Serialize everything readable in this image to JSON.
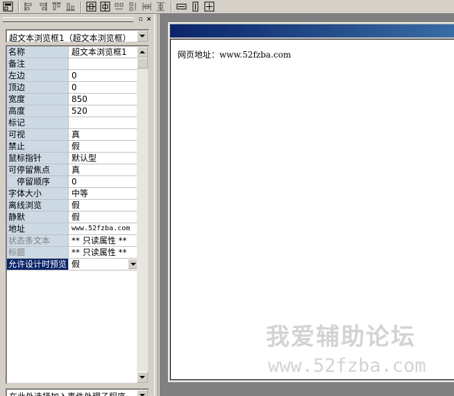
{
  "toolbar": {
    "buttons": [
      "form-icon",
      "align-left-icon",
      "align-right-icon",
      "align-top-icon",
      "align-bottom-icon",
      "center-horizontal-icon",
      "center-vertical-icon",
      "space-horizontal-icon",
      "space-vertical-icon",
      "distribute-horizontal-icon",
      "distribute-vertical-icon",
      "same-width-icon",
      "same-height-icon",
      "same-size-icon"
    ]
  },
  "panel": {
    "restore_glyph": "▫",
    "close_glyph": "×",
    "object_selector": "超文本浏览框1（超文本浏览框）",
    "event_selector": "在此处选择加入事件处理子程序"
  },
  "properties": [
    {
      "name": "名称",
      "value": "超文本浏览框1"
    },
    {
      "name": "备注",
      "value": ""
    },
    {
      "name": "左边",
      "value": "0"
    },
    {
      "name": "顶边",
      "value": "0"
    },
    {
      "name": "宽度",
      "value": "850"
    },
    {
      "name": "高度",
      "value": "520"
    },
    {
      "name": "标记",
      "value": ""
    },
    {
      "name": "可视",
      "value": "真"
    },
    {
      "name": "禁止",
      "value": "假"
    },
    {
      "name": "鼠标指针",
      "value": "默认型"
    },
    {
      "name": "可停留焦点",
      "value": "真"
    },
    {
      "name": "停留顺序",
      "value": "0"
    },
    {
      "name": "字体大小",
      "value": "中等"
    },
    {
      "name": "离线浏览",
      "value": "假"
    },
    {
      "name": "静默",
      "value": "假"
    },
    {
      "name": "地址",
      "value": "www.52fzba.com"
    },
    {
      "name": "状态条文本",
      "value": "** 只读属性 **"
    },
    {
      "name": "标题",
      "value": "** 只读属性 **"
    },
    {
      "name": "允许设计时预览",
      "value": "假"
    }
  ],
  "design": {
    "browser_text": "网页地址：www.52fzba.com"
  },
  "watermark": {
    "title": "我爱辅助论坛",
    "url": "www.52fzba.com"
  },
  "colors": {
    "name_cell_bg": "#cdd9e5",
    "selected_bg": "#0a246a",
    "titlebar_start": "#0a246a",
    "titlebar_end": "#3a6ea5"
  }
}
